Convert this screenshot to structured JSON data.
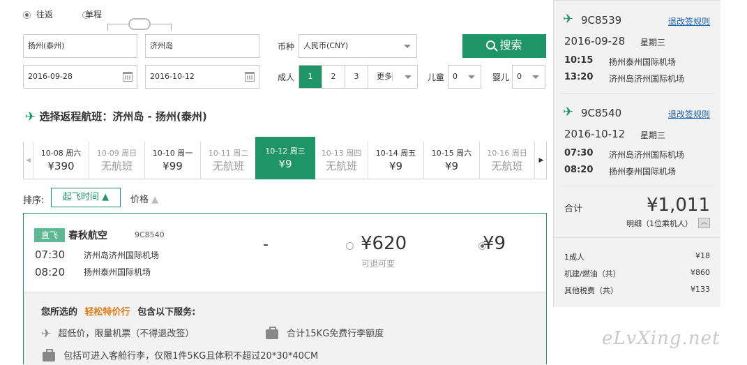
{
  "trip_type": {
    "round": "往返",
    "oneway": "单程"
  },
  "from_city": "扬州(泰州)",
  "to_city": "济州岛",
  "currency": {
    "label": "币种",
    "value": "人民币(CNY)"
  },
  "depart_date": "2016-09-28",
  "return_date": "2016-10-12",
  "adults": {
    "label": "成人",
    "options": [
      "1",
      "2",
      "3"
    ],
    "more": "更多",
    "selected": "1"
  },
  "children": {
    "label": "儿童",
    "value": "0"
  },
  "infants": {
    "label": "婴儿",
    "value": "0"
  },
  "search_label": "搜索",
  "section_title": "选择返程航班：济州岛 - 扬州(泰州)",
  "date_tabs": [
    {
      "date": "10-08 周六",
      "price": "¥390",
      "ok": true
    },
    {
      "date": "10-09 周日",
      "price": "无航班",
      "ok": false
    },
    {
      "date": "10-10 周一",
      "price": "¥99",
      "ok": true
    },
    {
      "date": "10-11 周二",
      "price": "无航班",
      "ok": false
    },
    {
      "date": "10-12 周三",
      "price": "¥9",
      "ok": true,
      "selected": true
    },
    {
      "date": "10-13 周四",
      "price": "无航班",
      "ok": false
    },
    {
      "date": "10-14 周五",
      "price": "¥9",
      "ok": true
    },
    {
      "date": "10-15 周六",
      "price": "¥9",
      "ok": true
    },
    {
      "date": "10-16 周日",
      "price": "无航班",
      "ok": false
    }
  ],
  "sort": {
    "label": "排序:",
    "by_time": "起飞时间",
    "by_price": "价格"
  },
  "flight": {
    "badge": "直飞",
    "airline": "春秋航空",
    "number": "9C8540",
    "dep_time": "07:30",
    "dep_airport": "济州岛济州国际机场",
    "arr_time": "08:20",
    "arr_airport": "扬州泰州国际机场",
    "dash": "-",
    "fare1": "¥620",
    "fare1_note": "可退可变",
    "fare2": "¥9"
  },
  "service": {
    "intro_a": "您所选的",
    "intro_b": "轻松特价行",
    "intro_c": "包含以下服务:",
    "item1": "超低价，限量机票（不得退改签）",
    "item2": "合计15KG免费行李额度",
    "item3": "包括可进入客舱行李，仅限1件5KG且体积不超过20*30*40CM"
  },
  "summary": {
    "legs": [
      {
        "flight": "9C8539",
        "rules": "退改签规则",
        "date": "2016-09-28",
        "weekday": "星期三",
        "dep_time": "10:15",
        "dep_airport": "扬州泰州国际机场",
        "arr_time": "13:20",
        "arr_airport": "济州岛济州国际机场"
      },
      {
        "flight": "9C8540",
        "rules": "退改签规则",
        "date": "2016-10-12",
        "weekday": "星期三",
        "dep_time": "07:30",
        "dep_airport": "济州岛济州国际机场",
        "arr_time": "08:20",
        "arr_airport": "扬州泰州国际机场"
      }
    ],
    "total_label": "合计",
    "total": "¥1,011",
    "detail": "明细（1位乘机人）",
    "breakdown": [
      {
        "label": "1成人",
        "value": "¥18"
      },
      {
        "label": "机建/燃油（共）",
        "value": "¥860"
      },
      {
        "label": "其他税费（共）",
        "value": "¥133"
      }
    ]
  },
  "watermark": "eLvXing.net",
  "colors": {
    "brand": "#1f9466",
    "orange": "#e07a10",
    "link": "#1a5fa8"
  }
}
